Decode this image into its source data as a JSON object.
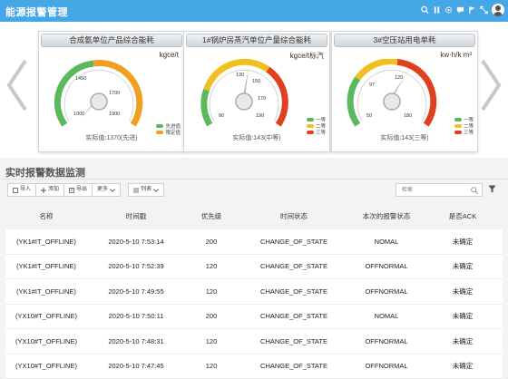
{
  "app": {
    "title": "能源报警管理"
  },
  "header_icons": [
    "search-icon",
    "pause-icon",
    "settings-icon",
    "message-icon",
    "flag-icon",
    "expand-icon"
  ],
  "gauges": [
    {
      "title": "合成氨单位产品综合能耗",
      "unit": "kgce/t",
      "min": 1000,
      "max": 1900,
      "ticks": [
        "1000",
        "1450",
        "1700",
        "1900"
      ],
      "value": 1370,
      "actual_text": "实际值:1370(先进)",
      "legend": [
        {
          "label": "先进值",
          "color": "#5cb85c"
        },
        {
          "label": "限定值",
          "color": "#f0a020"
        }
      ]
    },
    {
      "title": "1#锅炉房蒸汽单位产量综合能耗",
      "unit": "kgce/t标汽",
      "min": 90,
      "max": 190,
      "ticks": [
        "90",
        "130",
        "150",
        "170",
        "190"
      ],
      "value": 143,
      "actual_text": "实际值:143(中等)",
      "legend": [
        {
          "label": "一等",
          "color": "#5cb85c"
        },
        {
          "label": "二等",
          "color": "#f0c020"
        },
        {
          "label": "三等",
          "color": "#e04020"
        }
      ]
    },
    {
      "title": "3#空压站用电单耗",
      "unit": "kw·h/k m³",
      "min": 50,
      "max": 180,
      "ticks": [
        "50",
        "97",
        "120",
        "180"
      ],
      "value": 143,
      "actual_text": "实际值:143(三等)",
      "legend": [
        {
          "label": "一等",
          "color": "#5cb85c"
        },
        {
          "label": "二等",
          "color": "#f0c020"
        },
        {
          "label": "三等",
          "color": "#e04020"
        }
      ]
    }
  ],
  "section": {
    "title": "实时报警数据监测"
  },
  "toolbar": {
    "import_label": "导入",
    "add_label": "添加",
    "export_label": "导出",
    "more_label": "更多",
    "columns_label": "列表"
  },
  "search": {
    "placeholder": "检索"
  },
  "table": {
    "headers": [
      "名称",
      "时间戳",
      "优先级",
      "时间状态",
      "本次的报警状态",
      "是否ACK"
    ],
    "rows": [
      [
        "(YK1#IT_OFFLINE)",
        "2020-5-10 7:53:14",
        "200",
        "CHANGE_OF_STATE",
        "NOMAL",
        "未确定"
      ],
      [
        "(YK1#IT_OFFLINE)",
        "2020-5-10 7:52:39",
        "120",
        "CHANGE_OF_STATE",
        "OFFNORMAL",
        "未确定"
      ],
      [
        "(YK1#IT_OFFLINE)",
        "2020-5-10 7:49:55",
        "120",
        "CHANGE_OF_STATE",
        "OFFNORMAL",
        "未确定"
      ],
      [
        "(YX10#T_OFFLINE)",
        "2020-5-10 7:50:11",
        "200",
        "CHANGE_OF_STATE",
        "NOMAL",
        "未确定"
      ],
      [
        "(YX10#T_OFFLINE)",
        "2020-5-10 7:48:31",
        "120",
        "CHANGE_OF_STATE",
        "OFFNORMAL",
        "未确定"
      ],
      [
        "(YX10#T_OFFLINE)",
        "2020-5-10 7:47:45",
        "120",
        "CHANGE_OF_STATE",
        "OFFNORMAL",
        "未确定"
      ]
    ]
  }
}
